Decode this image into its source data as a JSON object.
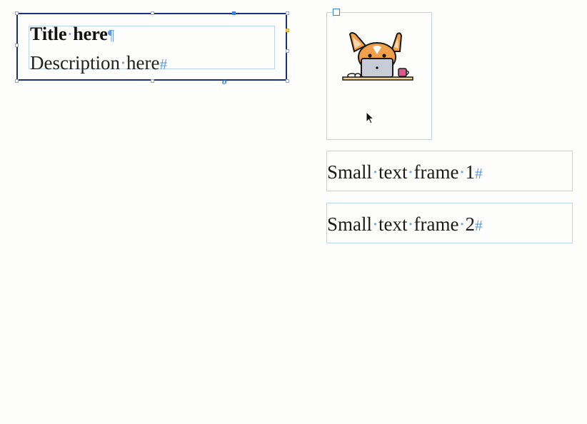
{
  "group": {
    "title": "Title here",
    "title_words": [
      "Title",
      "here"
    ],
    "title_end_mark": "¶",
    "description_words": [
      "Description",
      "here"
    ],
    "description_end_mark": "#",
    "link_glyph": "o"
  },
  "image": {
    "icon": "corgi-laptop-illustration"
  },
  "small_frames": [
    {
      "words": [
        "Small",
        "text",
        "frame",
        "1"
      ],
      "end_mark": "#"
    },
    {
      "words": [
        "Small",
        "text",
        "frame",
        "2"
      ],
      "end_mark": "#"
    }
  ],
  "separator_glyph": "·",
  "colors": {
    "selection": "#1c2f7a",
    "frame_edge": "#bcd4ef",
    "hidden_chars": "#5b9ae6",
    "corgi_orange": "#f0a04a",
    "laptop_gray": "#c8ccd6",
    "mug_pink": "#e0588a"
  }
}
